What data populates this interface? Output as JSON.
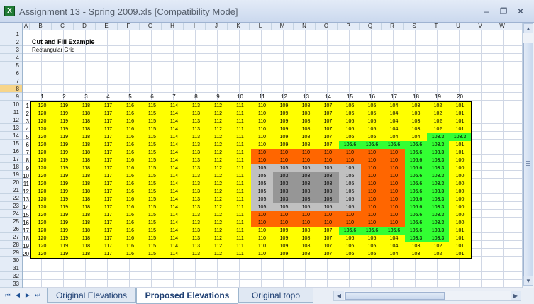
{
  "window": {
    "title": "Assignment 13 - Spring 2009.xls  [Compatibility Mode]",
    "app_icon": "excel-icon",
    "minimize_glyph": "–",
    "restore_glyph": "❐",
    "close_glyph": "✕"
  },
  "columns": [
    "A",
    "B",
    "C",
    "D",
    "E",
    "F",
    "G",
    "H",
    "I",
    "J",
    "K",
    "L",
    "M",
    "N",
    "O",
    "P",
    "Q",
    "R",
    "S",
    "T",
    "U",
    "V",
    "W"
  ],
  "rows": [
    "1",
    "2",
    "3",
    "4",
    "5",
    "6",
    "7",
    "8",
    "9",
    "10",
    "11",
    "12",
    "13",
    "14",
    "15",
    "16",
    "17",
    "18",
    "19",
    "20",
    "21",
    "22",
    "23",
    "24",
    "25",
    "26",
    "27",
    "28",
    "29",
    "30",
    "31",
    "32",
    "33"
  ],
  "selected_row": "8",
  "sheet": {
    "title": "Cut and Fill Example",
    "subtitle": "Rectangular Grid",
    "col_numbers": [
      "1",
      "2",
      "3",
      "4",
      "5",
      "6",
      "7",
      "8",
      "9",
      "10",
      "11",
      "12",
      "13",
      "14",
      "15",
      "16",
      "17",
      "18",
      "19",
      "20"
    ],
    "row_numbers": [
      "1",
      "2",
      "3",
      "4",
      "5",
      "6",
      "7",
      "8",
      "9",
      "10",
      "11",
      "12",
      "13",
      "14",
      "15",
      "16",
      "17",
      "18",
      "19",
      "20"
    ],
    "base_values": [
      "120",
      "119",
      "118",
      "117",
      "116",
      "115",
      "114",
      "113",
      "112",
      "111",
      "110",
      "109",
      "108",
      "107",
      "106",
      "105",
      "104",
      "103",
      "102",
      "101"
    ],
    "overrides": {
      "4": {
        "17": "104",
        "18": "103.3",
        "19": "103.3"
      },
      "5": {
        "14": "106.6",
        "15": "106.6",
        "16": "106.6",
        "17": "106.6",
        "18": "103.3"
      },
      "6": {
        "10": "110",
        "11": "110",
        "12": "110",
        "13": "110",
        "14": "110",
        "15": "110",
        "16": "110",
        "17": "106.6",
        "18": "103.3"
      },
      "7": {
        "10": "110",
        "11": "110",
        "12": "110",
        "13": "110",
        "14": "110",
        "15": "110",
        "16": "110",
        "17": "106.6",
        "18": "103.3",
        "19": "100"
      },
      "8": {
        "10": "105",
        "11": "105",
        "12": "105",
        "13": "105",
        "14": "105",
        "15": "110",
        "16": "110",
        "17": "106.6",
        "18": "103.3",
        "19": "100"
      },
      "9": {
        "10": "105",
        "11": "103",
        "12": "103",
        "13": "103",
        "14": "105",
        "15": "110",
        "16": "110",
        "17": "106.6",
        "18": "103.3",
        "19": "100"
      },
      "10": {
        "10": "105",
        "11": "103",
        "12": "103",
        "13": "103",
        "14": "105",
        "15": "110",
        "16": "110",
        "17": "106.6",
        "18": "103.3",
        "19": "100"
      },
      "11": {
        "10": "105",
        "11": "103",
        "12": "103",
        "13": "103",
        "14": "105",
        "15": "110",
        "16": "110",
        "17": "106.6",
        "18": "103.3",
        "19": "100"
      },
      "12": {
        "10": "105",
        "11": "103",
        "12": "103",
        "13": "103",
        "14": "105",
        "15": "110",
        "16": "110",
        "17": "106.6",
        "18": "103.3",
        "19": "100"
      },
      "13": {
        "10": "105",
        "11": "105",
        "12": "105",
        "13": "105",
        "14": "105",
        "15": "110",
        "16": "110",
        "17": "106.6",
        "18": "103.3",
        "19": "100"
      },
      "14": {
        "10": "110",
        "11": "110",
        "12": "110",
        "13": "110",
        "14": "110",
        "15": "110",
        "16": "110",
        "17": "106.6",
        "18": "103.3",
        "19": "100"
      },
      "15": {
        "10": "110",
        "11": "110",
        "12": "110",
        "13": "110",
        "14": "110",
        "15": "110",
        "16": "110",
        "17": "106.6",
        "18": "103.3",
        "19": "100"
      },
      "16": {
        "14": "106.6",
        "15": "106.6",
        "16": "106.6",
        "17": "106.6",
        "18": "103.3"
      },
      "17": {
        "17": "103.3",
        "18": "103.3"
      }
    },
    "colors": {
      "yellow": "#ffff00",
      "green": "#33ff33",
      "orange": "#ff6600",
      "light_gray": "#c0c0c0",
      "dark_gray": "#969696"
    }
  },
  "tabs": {
    "sheets": [
      "Original Elevations",
      "Proposed Elevations",
      "Original topo"
    ],
    "active": "Proposed Elevations",
    "nav_first": "⏮",
    "nav_prev": "◀",
    "nav_next": "▶",
    "nav_last": "⏭"
  },
  "scroll": {
    "up": "▲",
    "down": "▼",
    "left": "◀",
    "right": "▶"
  }
}
